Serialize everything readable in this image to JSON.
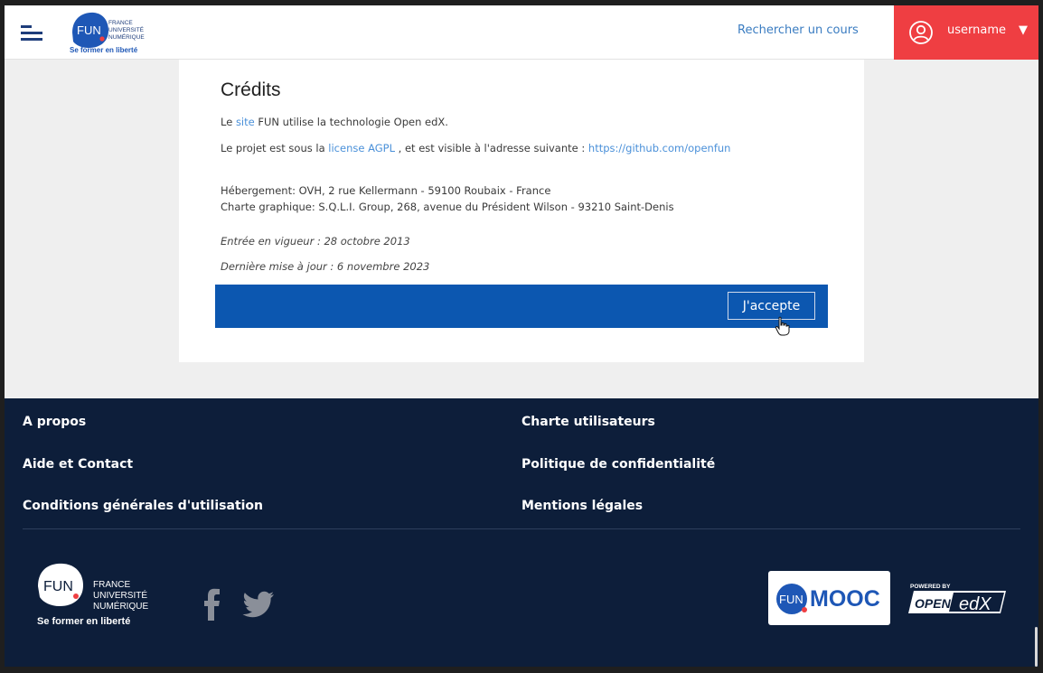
{
  "header": {
    "logo": {
      "line1": "FRANCE",
      "line2": "UNIVERSITÉ",
      "line3": "NUMÉRIQUE",
      "mark": "FUN",
      "tagline": "Se former en liberté"
    },
    "search_link": "Rechercher un cours",
    "user": {
      "name": "username",
      "caret": "▼",
      "icon": "user-circle-icon"
    },
    "menu_icon": "hamburger-icon",
    "colors": {
      "brand_blue": "#1e3d7b",
      "accent_red": "#ef3e42",
      "link_blue": "#3a7cc1"
    }
  },
  "card": {
    "title": "Crédits",
    "line1": {
      "prefix": "Le",
      "link": "site",
      "suffix": "FUN utilise la technologie Open edX."
    },
    "line2": {
      "prefix": "Le projet est sous la",
      "link": "license AGPL",
      "middle": ", et est visible à l'adresse suivante :",
      "url": "https://github.com/openfun"
    },
    "hosting": "Hébergement: OVH, 2 rue Kellermann - 59100 Roubaix - France",
    "design": "Charte graphique: S.Q.L.I. Group, 268, avenue du Président Wilson - 93210 Saint-Denis",
    "effective": "Entrée en vigueur : 28 octobre 2013",
    "updated": "Dernière mise à jour : 6 novembre 2023",
    "accept_label": "J'accepte",
    "bar_color": "#0c57b0"
  },
  "footer": {
    "links": {
      "about": "A propos",
      "charter": "Charte utilisateurs",
      "help": "Aide et Contact",
      "privacy": "Politique de confidentialité",
      "terms": "Conditions générales d'utilisation",
      "legal": "Mentions légales"
    },
    "logo": {
      "mark": "FUN",
      "line1": "FRANCE",
      "line2": "UNIVERSITÉ",
      "line3": "NUMÉRIQUE",
      "tagline": "Se former en liberté"
    },
    "social": [
      "facebook-icon",
      "twitter-icon"
    ],
    "funmooc": {
      "fun": "FUN",
      "mooc": "MOOC"
    },
    "openedx": {
      "powered": "POWERED BY",
      "open": "OPEN",
      "edx": "edX"
    },
    "bg_color": "#0d1e3a"
  }
}
